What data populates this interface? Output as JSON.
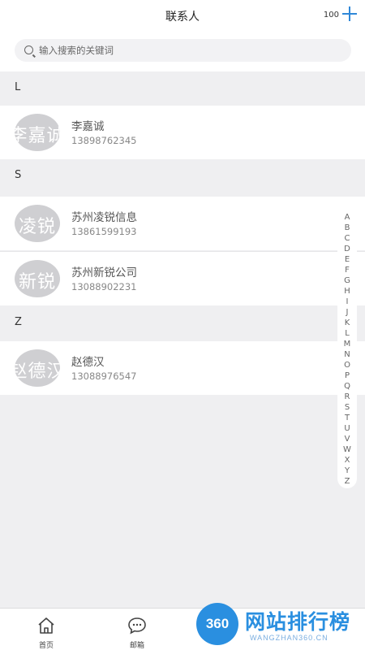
{
  "header": {
    "title": "联系人",
    "count": "100"
  },
  "search": {
    "placeholder": "输入搜索的关键词",
    "value": ""
  },
  "sections": [
    {
      "letter": "L",
      "contacts": [
        {
          "avatar_text": "李嘉诚",
          "name": "李嘉诚",
          "phone": "13898762345"
        }
      ]
    },
    {
      "letter": "S",
      "contacts": [
        {
          "avatar_text": "凌锐",
          "name": "苏州凌锐信息",
          "phone": "13861599193"
        },
        {
          "avatar_text": "新锐",
          "name": "苏州新锐公司",
          "phone": "13088902231"
        }
      ]
    },
    {
      "letter": "Z",
      "contacts": [
        {
          "avatar_text": "赵德汉",
          "name": "赵德汉",
          "phone": "13088976547"
        }
      ]
    }
  ],
  "index_letters": [
    "A",
    "B",
    "C",
    "D",
    "E",
    "F",
    "G",
    "H",
    "I",
    "J",
    "K",
    "L",
    "M",
    "N",
    "O",
    "P",
    "Q",
    "R",
    "S",
    "T",
    "U",
    "V",
    "W",
    "X",
    "Y",
    "Z"
  ],
  "bottom_nav": {
    "home": "首页",
    "mail": "邮箱"
  },
  "watermark": {
    "badge": "360",
    "text": "网站排行榜",
    "url": "WANGZHAN360.CN"
  },
  "colors": {
    "accent": "#2f88d8",
    "watermark": "#2a8fe0"
  }
}
